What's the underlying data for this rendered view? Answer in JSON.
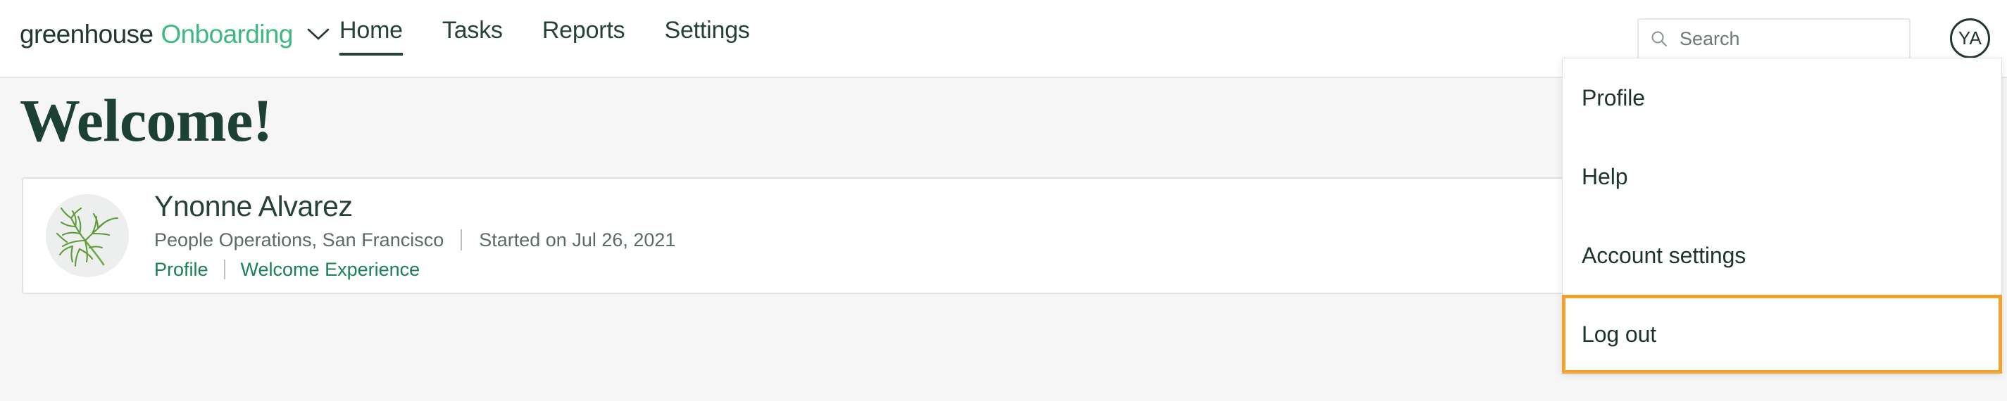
{
  "header": {
    "brand": {
      "name": "greenhouse",
      "product": "Onboarding",
      "chevron_icon": "chevron-down-icon"
    },
    "nav": [
      {
        "label": "Home",
        "active": true
      },
      {
        "label": "Tasks",
        "active": false
      },
      {
        "label": "Reports",
        "active": false
      },
      {
        "label": "Settings",
        "active": false
      }
    ],
    "search": {
      "icon": "search-icon",
      "placeholder": "Search",
      "value": ""
    },
    "avatar": {
      "initials": "YA"
    }
  },
  "main": {
    "title": "Welcome!",
    "employee": {
      "avatar_icon": "herb-sprig-avatar",
      "name": "Ynonne Alvarez",
      "department": "People Operations, San Francisco",
      "start_date": "Started on Jul 26, 2021",
      "links": [
        {
          "label": "Profile"
        },
        {
          "label": "Welcome Experience"
        }
      ]
    }
  },
  "account_menu": {
    "items": [
      {
        "label": "Profile",
        "highlighted": false
      },
      {
        "label": "Help",
        "highlighted": false
      },
      {
        "label": "Account settings",
        "highlighted": false
      },
      {
        "label": "Log out",
        "highlighted": true
      }
    ]
  },
  "colors": {
    "brand_green": "#40b884",
    "dark_green": "#21382f",
    "link_green": "#1a8055",
    "highlight_orange": "#f5a22d",
    "page_background": "#f6f6f6"
  }
}
